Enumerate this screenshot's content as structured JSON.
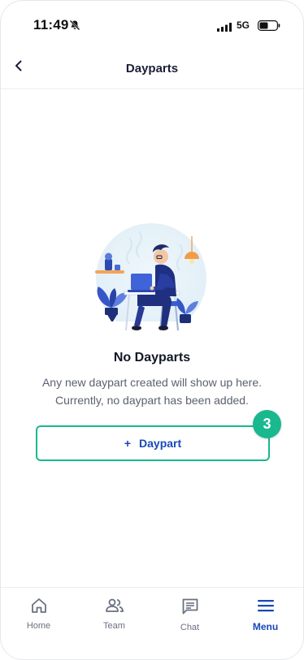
{
  "status_bar": {
    "time": "11:49",
    "network": "5G",
    "icons": [
      "bell-slash-icon",
      "signal-icon",
      "battery-icon"
    ]
  },
  "header": {
    "title": "Dayparts",
    "back_icon": "chevron-left-icon"
  },
  "empty_state": {
    "illustration": "person-working-on-laptop-illustration",
    "title": "No Dayparts",
    "description_line1": "Any new daypart created will show up here.",
    "description_line2": "Currently, no daypart has been added."
  },
  "add_button": {
    "icon": "+",
    "label": "Daypart"
  },
  "step_badge": {
    "number": "3"
  },
  "bottom_nav": {
    "items": [
      {
        "label": "Home",
        "icon": "home-icon",
        "active": false
      },
      {
        "label": "Team",
        "icon": "team-icon",
        "active": false
      },
      {
        "label": "Chat",
        "icon": "chat-icon",
        "active": false
      },
      {
        "label": "Menu",
        "icon": "menu-icon",
        "active": true
      }
    ]
  },
  "colors": {
    "accent_green": "#19b88f",
    "brand_blue": "#1848b8",
    "nav_inactive": "#6b7080"
  }
}
